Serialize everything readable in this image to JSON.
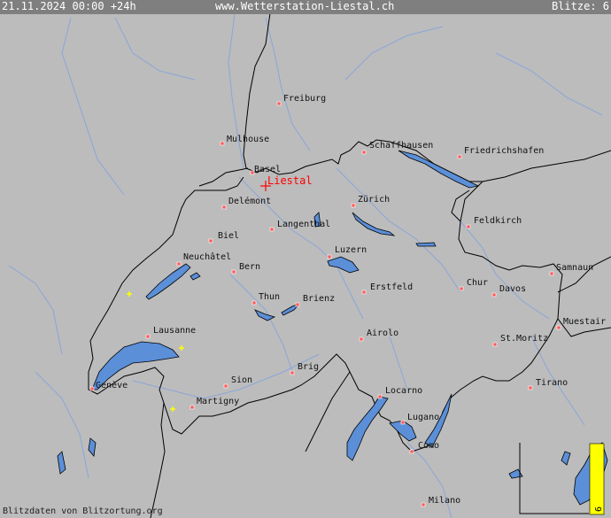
{
  "header": {
    "datetime": "21.11.2024 00:00 +24h",
    "site": "www.Wetterstation-Liestal.ch",
    "strikes": "Blitze: 6"
  },
  "footer": {
    "credit": "Blitzdaten von Blitzortung.org"
  },
  "station": {
    "name": "Liestal",
    "color": "#ff0000"
  },
  "cities": [
    "Freiburg",
    "Mulhouse",
    "Basel",
    "Delémont",
    "Schaffhausen",
    "Friedrichshafen",
    "Zürich",
    "Langenthal",
    "Biel",
    "Feldkirch",
    "Luzern",
    "Neuchâtel",
    "Bern",
    "Samnaun",
    "Erstfeld",
    "Chur",
    "Davos",
    "Thun",
    "Brienz",
    "Muestair",
    "Lausanne",
    "Airolo",
    "St.Moritz",
    "Sion",
    "Brig",
    "Genève",
    "Locarno",
    "Tirano",
    "Martigny",
    "Lugano",
    "Como",
    "Milano"
  ],
  "legend": {
    "count": "6",
    "bar_color": "#ffff00"
  },
  "colors": {
    "land": "#bcbcbc",
    "lake": "#5b8fd8",
    "river": "#8aa6d8",
    "border": "#000000",
    "city": "#ff0000",
    "strike": "#ffff00"
  }
}
